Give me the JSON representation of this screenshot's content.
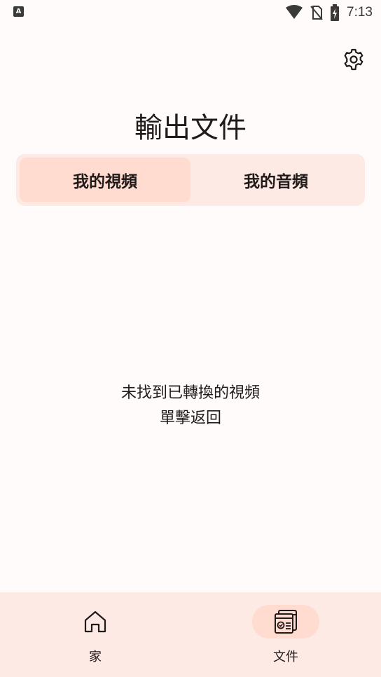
{
  "status_bar": {
    "notification_icon": "A",
    "time": "7:13",
    "icons": [
      "wifi-icon",
      "no-sim-icon",
      "battery-charging-icon"
    ]
  },
  "header": {
    "settings_icon": "gear-icon",
    "title": "輸出文件"
  },
  "tabs": [
    {
      "label": "我的視頻",
      "active": true
    },
    {
      "label": "我的音頻",
      "active": false
    }
  ],
  "empty_state": {
    "message": "未找到已轉換的視頻",
    "action": "單擊返回"
  },
  "bottom_nav": {
    "items": [
      {
        "label": "家",
        "icon": "home-icon",
        "active": false
      },
      {
        "label": "文件",
        "icon": "files-icon",
        "active": true
      }
    ]
  },
  "colors": {
    "background": "#fffbfa",
    "surface_tint": "#fdeae5",
    "active_tint": "#ffdbd0",
    "text": "#201a19"
  }
}
